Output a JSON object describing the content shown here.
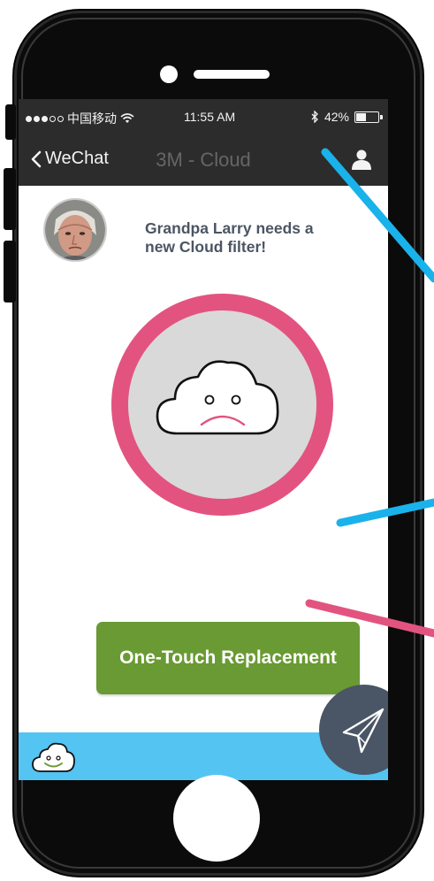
{
  "status_bar": {
    "carrier": "中国移动",
    "time": "11:55 AM",
    "battery": "42%",
    "battery_level": 0.42,
    "signal_dots_filled": 3,
    "signal_dots_total": 5
  },
  "nav": {
    "back_label": "WeChat",
    "title": "3M - Cloud",
    "back_icon": "chevron-left-icon",
    "right_icon": "user-icon"
  },
  "alert": {
    "message_line1": "Grandpa Larry needs a",
    "message_line2": "new Cloud filter!"
  },
  "status_indicator": {
    "icon": "sad-cloud-icon",
    "ring_color": "#e2547f",
    "fill_color": "#d9d9d9"
  },
  "actions": {
    "primary_label": "One-Touch Replacement",
    "primary_color": "#6a9a33"
  },
  "bottom_bar": {
    "color": "#54c4f2",
    "logo_icon": "happy-cloud-icon"
  },
  "fab": {
    "icon": "paper-plane-icon",
    "color": "#4a5566"
  },
  "annotation_colors": {
    "blue": "#1ab2ea",
    "pink": "#e2547f"
  }
}
